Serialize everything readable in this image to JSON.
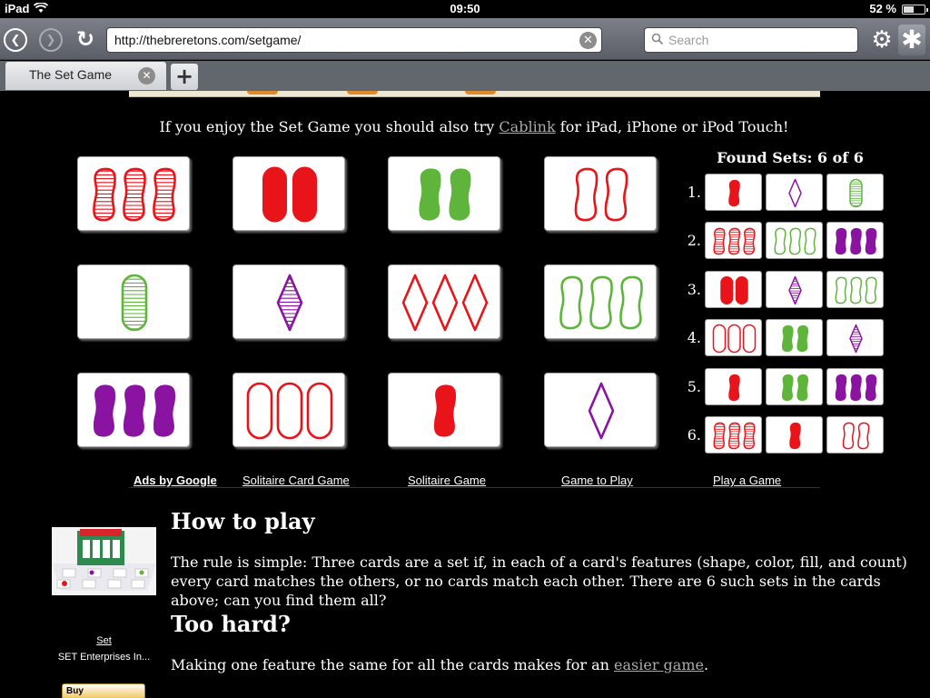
{
  "status_bar": {
    "carrier": "iPad",
    "time": "09:50",
    "battery": "52 %",
    "battery_level": 0.52
  },
  "toolbar": {
    "url": "http://thebreretons.com/setgame/",
    "search_placeholder": "Search"
  },
  "tabs": [
    {
      "label": "The Set Game"
    }
  ],
  "promo": {
    "before": "If you enjoy the Set Game you should also try ",
    "link": "Cablink",
    "after": " for iPad, iPhone or iPod Touch!"
  },
  "colors": {
    "red": "#e8141a",
    "green": "#5fb53b",
    "purple": "#8a13a2"
  },
  "board": [
    {
      "count": 3,
      "shape": "squiggle",
      "color": "red",
      "fill": "striped"
    },
    {
      "count": 2,
      "shape": "oval",
      "color": "red",
      "fill": "solid"
    },
    {
      "count": 2,
      "shape": "squiggle",
      "color": "green",
      "fill": "solid"
    },
    {
      "count": 2,
      "shape": "squiggle",
      "color": "red",
      "fill": "empty"
    },
    {
      "count": 1,
      "shape": "oval",
      "color": "green",
      "fill": "striped"
    },
    {
      "count": 1,
      "shape": "diamond",
      "color": "purple",
      "fill": "striped"
    },
    {
      "count": 3,
      "shape": "diamond",
      "color": "red",
      "fill": "empty"
    },
    {
      "count": 3,
      "shape": "squiggle",
      "color": "green",
      "fill": "empty"
    },
    {
      "count": 3,
      "shape": "squiggle",
      "color": "purple",
      "fill": "solid"
    },
    {
      "count": 3,
      "shape": "oval",
      "color": "red",
      "fill": "empty"
    },
    {
      "count": 1,
      "shape": "squiggle",
      "color": "red",
      "fill": "solid"
    },
    {
      "count": 1,
      "shape": "diamond",
      "color": "purple",
      "fill": "empty"
    }
  ],
  "found": {
    "title": "Found Sets: 6 of 6",
    "sets": [
      {
        "num": "1.",
        "cards": [
          {
            "count": 1,
            "shape": "squiggle",
            "color": "red",
            "fill": "solid"
          },
          {
            "count": 1,
            "shape": "diamond",
            "color": "purple",
            "fill": "empty"
          },
          {
            "count": 1,
            "shape": "oval",
            "color": "green",
            "fill": "striped"
          }
        ]
      },
      {
        "num": "2.",
        "cards": [
          {
            "count": 3,
            "shape": "squiggle",
            "color": "red",
            "fill": "striped"
          },
          {
            "count": 3,
            "shape": "squiggle",
            "color": "green",
            "fill": "empty"
          },
          {
            "count": 3,
            "shape": "squiggle",
            "color": "purple",
            "fill": "solid"
          }
        ]
      },
      {
        "num": "3.",
        "cards": [
          {
            "count": 2,
            "shape": "oval",
            "color": "red",
            "fill": "solid"
          },
          {
            "count": 1,
            "shape": "diamond",
            "color": "purple",
            "fill": "striped"
          },
          {
            "count": 3,
            "shape": "squiggle",
            "color": "green",
            "fill": "empty"
          }
        ]
      },
      {
        "num": "4.",
        "cards": [
          {
            "count": 3,
            "shape": "oval",
            "color": "red",
            "fill": "empty"
          },
          {
            "count": 2,
            "shape": "squiggle",
            "color": "green",
            "fill": "solid"
          },
          {
            "count": 1,
            "shape": "diamond",
            "color": "purple",
            "fill": "striped"
          }
        ]
      },
      {
        "num": "5.",
        "cards": [
          {
            "count": 1,
            "shape": "squiggle",
            "color": "red",
            "fill": "solid"
          },
          {
            "count": 2,
            "shape": "squiggle",
            "color": "green",
            "fill": "solid"
          },
          {
            "count": 3,
            "shape": "squiggle",
            "color": "purple",
            "fill": "solid"
          }
        ]
      },
      {
        "num": "6.",
        "cards": [
          {
            "count": 3,
            "shape": "squiggle",
            "color": "red",
            "fill": "striped"
          },
          {
            "count": 1,
            "shape": "squiggle",
            "color": "red",
            "fill": "solid"
          },
          {
            "count": 2,
            "shape": "squiggle",
            "color": "red",
            "fill": "empty"
          }
        ]
      }
    ]
  },
  "ads": {
    "label": "Ads by Google",
    "links": [
      "Solitaire Card Game",
      "Solitaire Game",
      "Game to Play",
      "Play a Game"
    ]
  },
  "product": {
    "name": "Set",
    "maker": "SET Enterprises In...",
    "buy": "Buy amazon.com"
  },
  "how_to_play": {
    "heading": "How to play",
    "text": "The rule is simple: Three cards are a set if, in each of a card's features (shape, color, fill, and count) every card matches the others, or no cards match each other. There are 6 such sets in the cards above; can you find them all?"
  },
  "too_hard": {
    "heading": "Too hard?",
    "before": "Making one feature the same for all the cards makes for an ",
    "link": "easier game",
    "after": "."
  }
}
